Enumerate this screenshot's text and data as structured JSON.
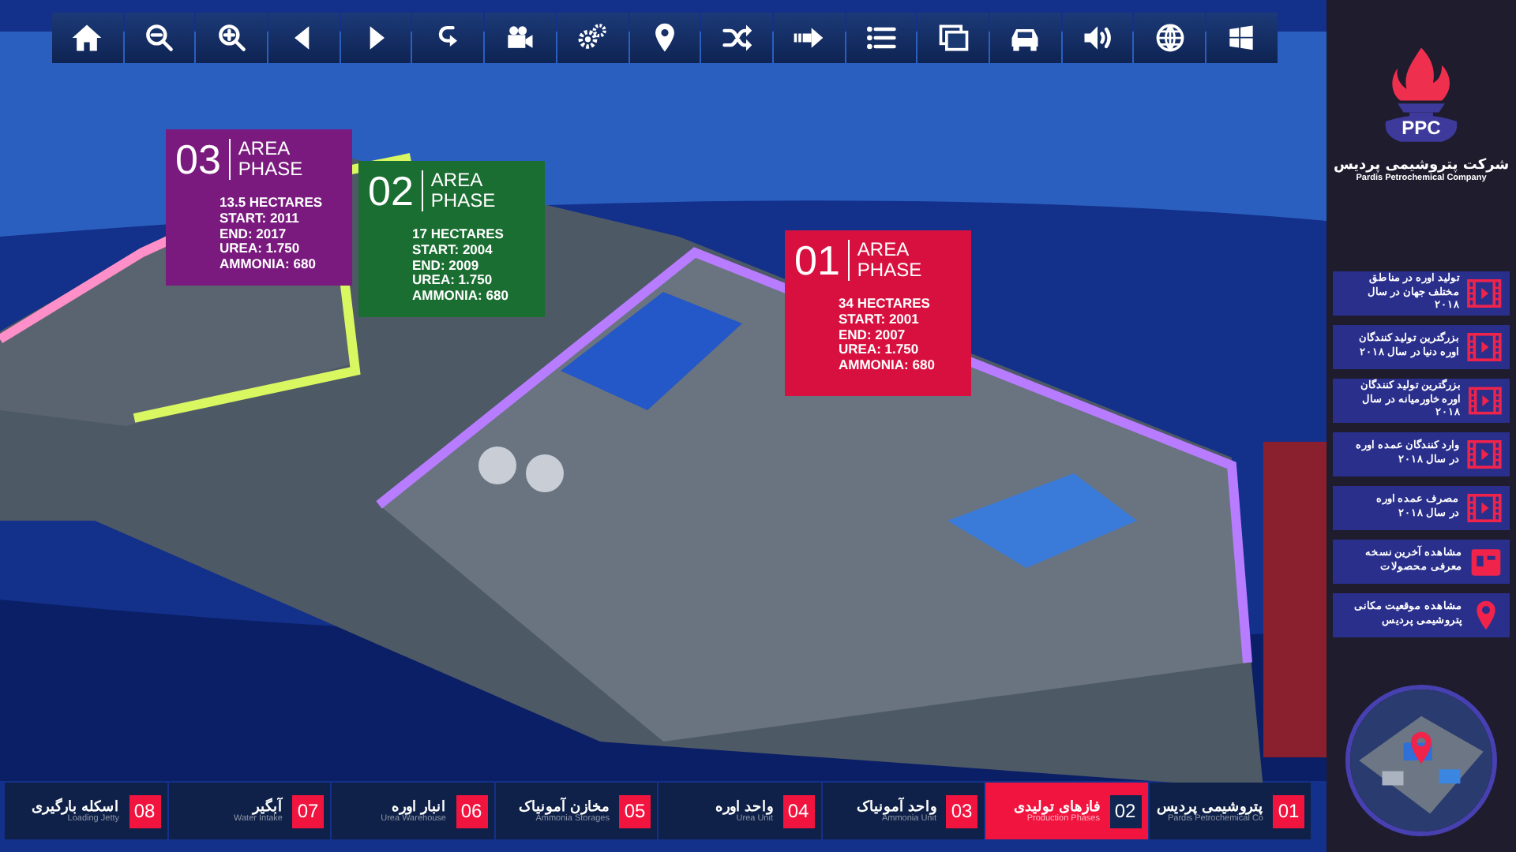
{
  "logo": {
    "mark": "PPC",
    "name": "شرکت پتروشیمی پردیس",
    "name_en": "Pardis Petrochemical Company"
  },
  "phase_cards": [
    {
      "number": "03",
      "title": "AREA\nPHASE",
      "color": "#7a1a7e",
      "details": [
        "13.5 HECTARES",
        "START: 2011",
        "END: 2017",
        "UREA: 1.750",
        "AMMONIA: 680"
      ]
    },
    {
      "number": "02",
      "title": "AREA\nPHASE",
      "color": "#1a6e32",
      "details": [
        "17 HECTARES",
        "START: 2004",
        "END: 2009",
        "UREA: 1.750",
        "AMMONIA: 680"
      ]
    },
    {
      "number": "01",
      "title": "AREA\nPHASE",
      "color": "#d8103f",
      "details": [
        "34 HECTARES",
        "START: 2001",
        "END: 2007",
        "UREA: 1.750",
        "AMMONIA: 680"
      ]
    }
  ],
  "side_menu": [
    {
      "kind": "video",
      "label": "تولید اوره در مناطق\nمختلف جهان در سال ۲۰۱۸"
    },
    {
      "kind": "video",
      "label": "بزرگترین تولید کنندگان\nاوره دنیا در سال ۲۰۱۸"
    },
    {
      "kind": "video",
      "label": "بزرگترین تولید کنندگان\nاوره خاورمیانه در سال ۲۰۱۸"
    },
    {
      "kind": "video",
      "label": "وارد کنندگان عمده اوره\nدر سال ۲۰۱۸"
    },
    {
      "kind": "video",
      "label": "مصرف عمده اوره\nدر سال ۲۰۱۸"
    },
    {
      "kind": "document",
      "label": "مشاهده آخرین نسخه\nمعرفی محصولات"
    },
    {
      "kind": "location",
      "label": "مشاهده موقعیت مکانی\nپتروشیمی پردیس"
    }
  ],
  "bottom_tabs": [
    {
      "number": "01",
      "title": "پتروشیمی پردیس",
      "subtitle": "Pardis Petrochemical Co",
      "selected": false
    },
    {
      "number": "02",
      "title": "فازهای تولیدی",
      "subtitle": "Production Phases",
      "selected": true
    },
    {
      "number": "03",
      "title": "واحد آمونیاک",
      "subtitle": "Ammonia Unit",
      "selected": false
    },
    {
      "number": "04",
      "title": "واحد اوره",
      "subtitle": "Urea Unit",
      "selected": false
    },
    {
      "number": "05",
      "title": "مخازن آمونیاک",
      "subtitle": "Ammonia Storages",
      "selected": false
    },
    {
      "number": "06",
      "title": "انبار اوره",
      "subtitle": "Urea Warehouse",
      "selected": false
    },
    {
      "number": "07",
      "title": "آبگیر",
      "subtitle": "Water Intake",
      "selected": false
    },
    {
      "number": "08",
      "title": "اسکله بارگیری",
      "subtitle": "Loading Jetty",
      "selected": false
    }
  ]
}
